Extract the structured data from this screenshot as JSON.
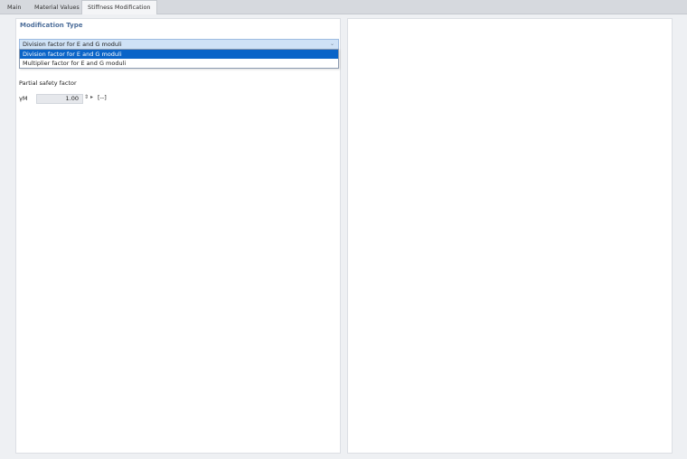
{
  "tabs": [
    {
      "label": "Main"
    },
    {
      "label": "Material Values"
    },
    {
      "label": "Stiffness Modification"
    }
  ],
  "modification": {
    "section_title": "Modification Type",
    "selected_value": "Division factor for E and G moduli",
    "options": [
      "Division factor for E and G moduli",
      "Multiplier factor for E and G moduli"
    ]
  },
  "safety": {
    "heading": "Partial safety factor",
    "symbol": "γM",
    "value": "1.00",
    "spin_glyph": "⇕",
    "expand_glyph": "▸",
    "unit": "[--]"
  },
  "icons": {
    "combo_arrow": "chevron-down-icon"
  },
  "colors": {
    "accent": "#0a64c8",
    "section_title": "#4e6f9b",
    "combo_bg": "#cfe2f6"
  }
}
